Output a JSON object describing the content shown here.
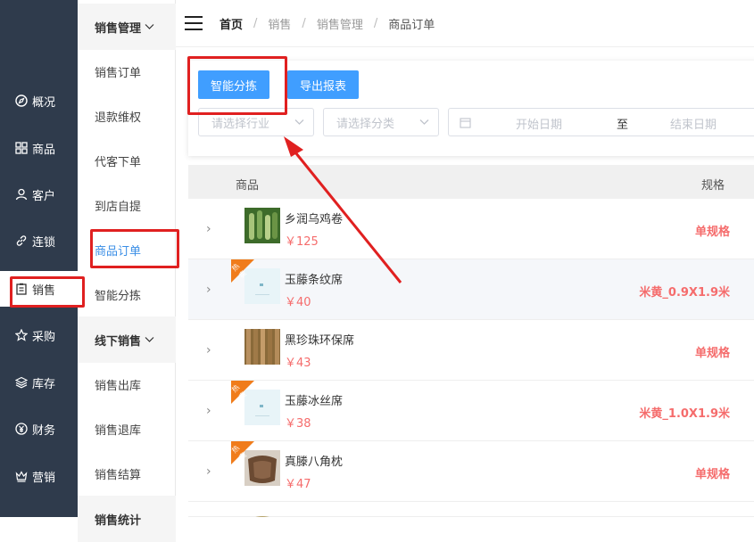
{
  "nav": {
    "items": [
      {
        "label": "概况",
        "icon": "compass-icon"
      },
      {
        "label": "商品",
        "icon": "grid-icon"
      },
      {
        "label": "客户",
        "icon": "user-icon"
      },
      {
        "label": "连锁",
        "icon": "link-icon"
      },
      {
        "label": "销售",
        "icon": "clipboard-icon"
      },
      {
        "label": "采购",
        "icon": "star-icon"
      },
      {
        "label": "库存",
        "icon": "layers-icon"
      },
      {
        "label": "财务",
        "icon": "yen-icon"
      },
      {
        "label": "营销",
        "icon": "crown-icon"
      }
    ],
    "active": "销售"
  },
  "submenu": {
    "group1": "销售管理",
    "items1": [
      "销售订单",
      "退款维权",
      "代客下单",
      "到店自提",
      "商品订单",
      "智能分拣"
    ],
    "group2": "线下销售",
    "items2": [
      "销售出库",
      "销售退库",
      "销售结算"
    ],
    "group3": "销售统计",
    "active": "商品订单"
  },
  "breadcrumb": [
    "首页",
    "销售",
    "销售管理",
    "商品订单"
  ],
  "filters": {
    "btn_sort": "智能分拣",
    "btn_export": "导出报表",
    "industry_placeholder": "请选择行业",
    "category_placeholder": "请选择分类",
    "start_date": "开始日期",
    "to": "至",
    "end_date": "结束日期"
  },
  "table": {
    "headers": {
      "product": "商品",
      "spec": "规格"
    },
    "rows": [
      {
        "name": "乡润乌鸡卷",
        "price": "￥125",
        "spec": "单规格",
        "badge": ""
      },
      {
        "name": "玉藤条纹席",
        "price": "￥40",
        "spec": "米黄_0.9X1.9米",
        "badge": "热卖"
      },
      {
        "name": "黑珍珠环保席",
        "price": "￥43",
        "spec": "单规格",
        "badge": ""
      },
      {
        "name": "玉藤冰丝席",
        "price": "￥38",
        "spec": "米黄_1.0X1.9米",
        "badge": "热卖"
      },
      {
        "name": "真滕八角枕",
        "price": "￥47",
        "spec": "单规格",
        "badge": "热卖"
      }
    ]
  },
  "colors": {
    "nav_bg": "#2f3b4c",
    "primary": "#409eff",
    "price_red": "#f56c6c",
    "annotation_red": "#e02020",
    "badge_orange": "#f07c1b"
  }
}
